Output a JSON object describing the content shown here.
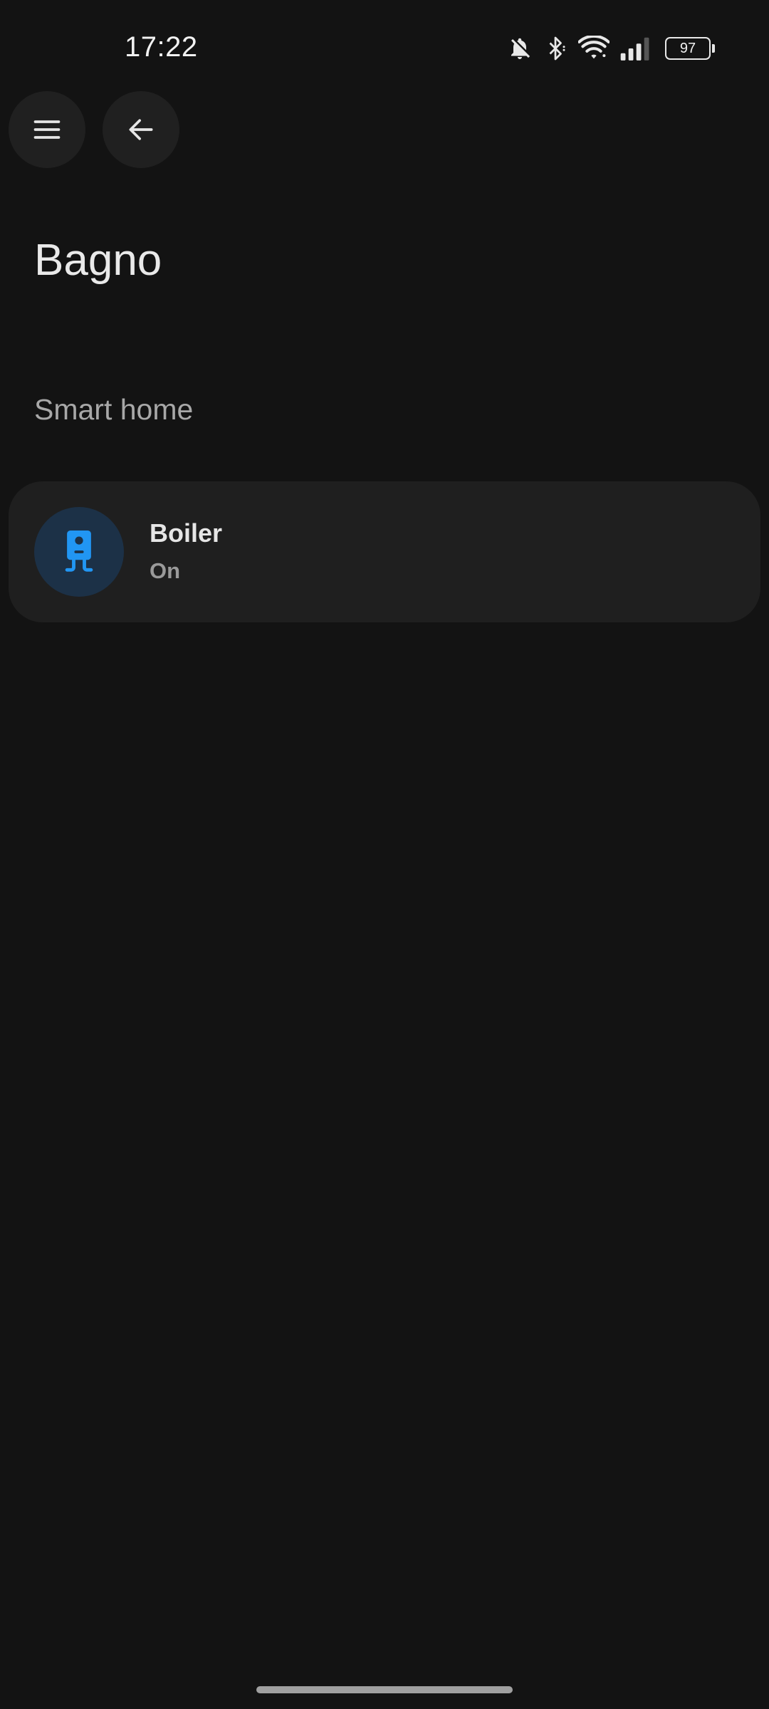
{
  "status_bar": {
    "time": "17:22",
    "battery": "97",
    "icons": [
      "bell-off-icon",
      "bluetooth-icon",
      "wifi-icon",
      "signal-icon",
      "battery-icon"
    ]
  },
  "nav": {
    "menu_icon": "menu-icon",
    "back_icon": "arrow-left-icon"
  },
  "page": {
    "title": "Bagno"
  },
  "sections": [
    {
      "title": "Smart home",
      "devices": [
        {
          "name": "Boiler",
          "state": "On",
          "icon": "boiler-icon",
          "icon_color": "#2196f3",
          "icon_bg": "#1c3147"
        }
      ]
    }
  ],
  "colors": {
    "background": "#131313",
    "card": "#1f1f1f",
    "accent": "#2196f3"
  }
}
